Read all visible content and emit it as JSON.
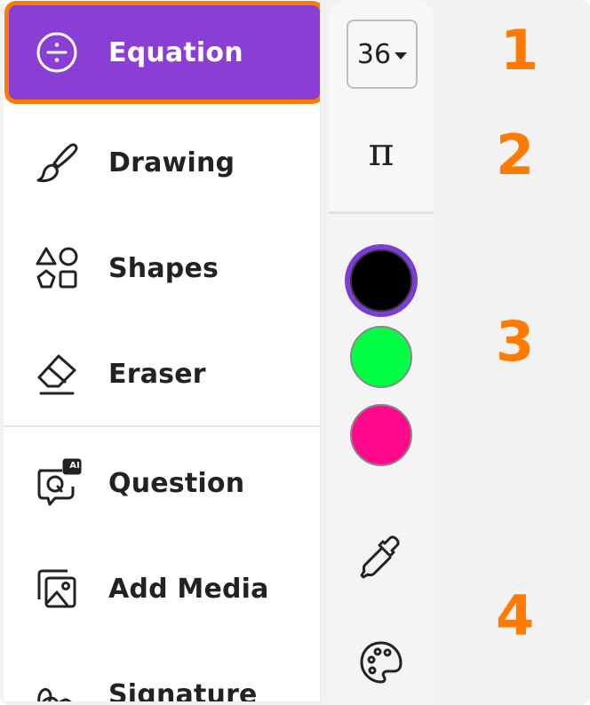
{
  "colors": {
    "accent": "#8a3ed4",
    "highlight": "#ff7a00"
  },
  "menu": {
    "items": [
      {
        "label": "Equation",
        "icon": "divide-icon",
        "active": true
      },
      {
        "label": "Drawing",
        "icon": "brush-icon"
      },
      {
        "label": "Shapes",
        "icon": "shapes-icon"
      },
      {
        "label": "Eraser",
        "icon": "eraser-icon"
      },
      {
        "label": "Question",
        "icon": "ai-question-icon",
        "badge": "AI"
      },
      {
        "label": "Add Media",
        "icon": "image-icon"
      },
      {
        "label": "Signature",
        "icon": "signature-icon"
      }
    ]
  },
  "toolbar": {
    "font_size": "36",
    "symbol": "π",
    "swatches": [
      {
        "name": "black",
        "color": "#000000",
        "selected": true
      },
      {
        "name": "green",
        "color": "#00ff44"
      },
      {
        "name": "pink",
        "color": "#ff0a8c"
      }
    ],
    "tools": [
      "eyedropper-icon",
      "palette-icon"
    ]
  },
  "callouts": [
    "1",
    "2",
    "3",
    "4"
  ]
}
